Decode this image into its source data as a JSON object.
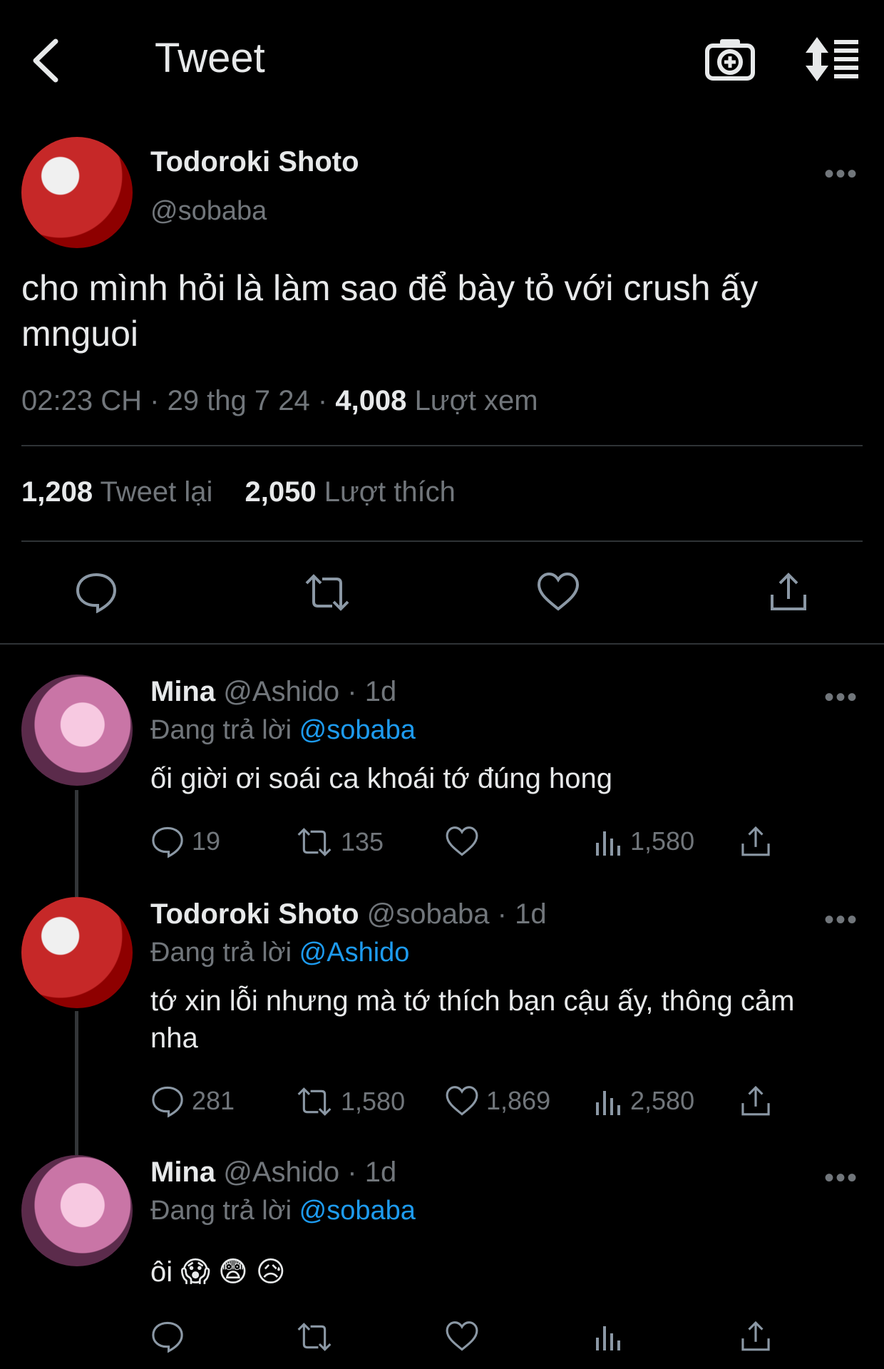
{
  "header": {
    "title": "Tweet",
    "icons": [
      "back-icon",
      "camera-add-icon",
      "sort-icon"
    ]
  },
  "tweet": {
    "name": "Todoroki Shoto",
    "handle": "@sobaba",
    "text": "cho mình hỏi là làm sao để bày tỏ với crush ấy mnguoi",
    "time": "02:23 CH",
    "date": "29 thg 7 24",
    "views": "4,008",
    "views_label": "Lượt xem",
    "retweets": "1,208",
    "retweets_label": "Tweet lại",
    "likes": "2,050",
    "likes_label": "Lượt thích",
    "more": "•••"
  },
  "replies": [
    {
      "name": "Mina",
      "handle": "@Ashido",
      "age": "1d",
      "replying_label": "Đang trả lời",
      "replying_to": "@sobaba",
      "text": "ối giời ơi soái ca khoái tớ đúng hong",
      "comments": "19",
      "retweets": "135",
      "likes": "",
      "views": "1,580"
    },
    {
      "name": "Todoroki Shoto",
      "handle": "@sobaba",
      "age": "1d",
      "replying_label": "Đang trả lời",
      "replying_to": "@Ashido",
      "text": "tớ xin lỗi nhưng mà tớ thích bạn cậu ấy, thông cảm nha",
      "comments": "281",
      "retweets": "1,580",
      "likes": "1,869",
      "views": "2,580"
    },
    {
      "name": "Mina",
      "handle": "@Ashido",
      "age": "1d",
      "replying_label": "Đang trả lời",
      "replying_to": "@sobaba",
      "text": "ôi 😱 😨 😥",
      "comments": "",
      "retweets": "",
      "likes": "",
      "views": ""
    }
  ],
  "separator": "·",
  "colors": {
    "background": "#000000",
    "text": "#e7e9ea",
    "muted": "#71767b",
    "link": "#1d9bf0",
    "divider": "#2f3336"
  }
}
